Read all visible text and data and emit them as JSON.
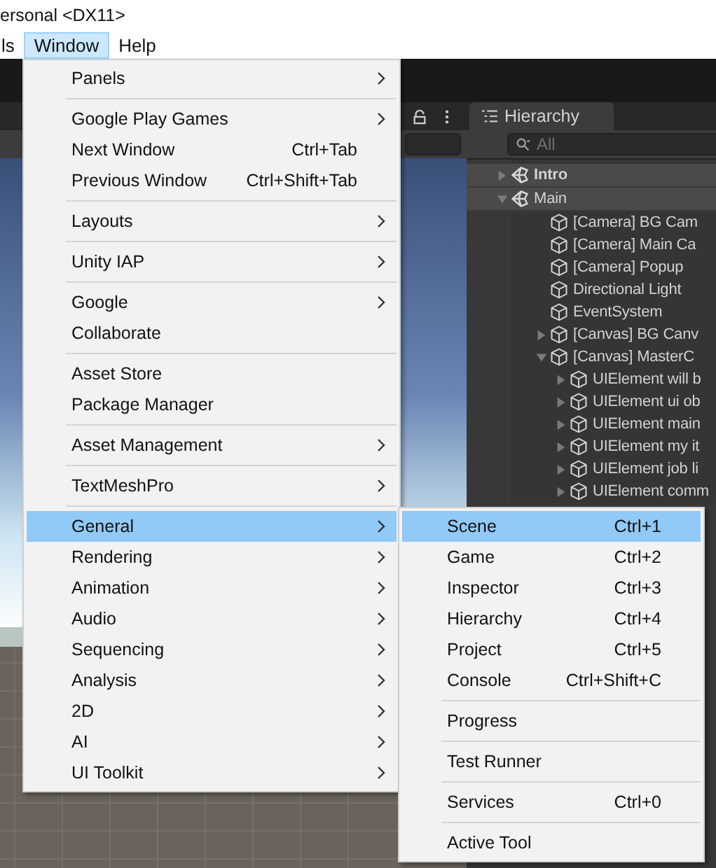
{
  "title_bar": {
    "title": "ersonal <DX11>"
  },
  "menu_bar": [
    {
      "label": "ls",
      "selected": false
    },
    {
      "label": "Window",
      "selected": true
    },
    {
      "label": "Help",
      "selected": false
    }
  ],
  "hierarchy": {
    "tab": "Hierarchy",
    "search": {
      "placeholder": "All"
    },
    "items": [
      {
        "label": "Intro",
        "kind": "scene",
        "active": true,
        "expanded": false
      },
      {
        "label": "Main",
        "kind": "scene",
        "active": false,
        "expanded": true,
        "children": [
          {
            "label": "[Camera] BG Cam",
            "kind": "object"
          },
          {
            "label": "[Camera] Main Ca",
            "kind": "object"
          },
          {
            "label": "[Camera] Popup",
            "kind": "object"
          },
          {
            "label": "Directional Light",
            "kind": "object"
          },
          {
            "label": "EventSystem",
            "kind": "object"
          },
          {
            "label": "[Canvas] BG Canv",
            "kind": "object",
            "expanded": false
          },
          {
            "label": "[Canvas] MasterC",
            "kind": "object",
            "expanded": true,
            "children": [
              {
                "label": "UIElement will b",
                "kind": "object",
                "expanded": false
              },
              {
                "label": "UIElement ui ob",
                "kind": "object",
                "expanded": false
              },
              {
                "label": "UIElement main",
                "kind": "object",
                "expanded": false
              },
              {
                "label": "UIElement my it",
                "kind": "object",
                "expanded": false
              },
              {
                "label": "UIElement job li",
                "kind": "object",
                "expanded": false
              },
              {
                "label": "UIElement comm",
                "kind": "object",
                "expanded": false
              }
            ]
          }
        ]
      }
    ]
  },
  "window_menu": {
    "groups": [
      [
        {
          "label": "Panels",
          "submenu": true,
          "selected": false
        }
      ],
      [
        {
          "label": "Google Play Games",
          "submenu": true,
          "selected": false
        },
        {
          "label": "Next Window",
          "shortcut": "Ctrl+Tab",
          "submenu": false,
          "selected": false
        },
        {
          "label": "Previous Window",
          "shortcut": "Ctrl+Shift+Tab",
          "submenu": false,
          "selected": false
        }
      ],
      [
        {
          "label": "Layouts",
          "submenu": true,
          "selected": false
        }
      ],
      [
        {
          "label": "Unity IAP",
          "submenu": true,
          "selected": false
        }
      ],
      [
        {
          "label": "Google",
          "submenu": true,
          "selected": false
        },
        {
          "label": "Collaborate",
          "submenu": false,
          "selected": false
        }
      ],
      [
        {
          "label": "Asset Store",
          "submenu": false,
          "selected": false
        },
        {
          "label": "Package Manager",
          "submenu": false,
          "selected": false
        }
      ],
      [
        {
          "label": "Asset Management",
          "submenu": true,
          "selected": false
        }
      ],
      [
        {
          "label": "TextMeshPro",
          "submenu": true,
          "selected": false
        }
      ],
      [
        {
          "label": "General",
          "submenu": true,
          "selected": true
        },
        {
          "label": "Rendering",
          "submenu": true,
          "selected": false
        },
        {
          "label": "Animation",
          "submenu": true,
          "selected": false
        },
        {
          "label": "Audio",
          "submenu": true,
          "selected": false
        },
        {
          "label": "Sequencing",
          "submenu": true,
          "selected": false
        },
        {
          "label": "Analysis",
          "submenu": true,
          "selected": false
        },
        {
          "label": "2D",
          "submenu": true,
          "selected": false
        },
        {
          "label": "AI",
          "submenu": true,
          "selected": false
        },
        {
          "label": "UI Toolkit",
          "submenu": true,
          "selected": false
        }
      ]
    ]
  },
  "general_submenu": {
    "groups": [
      [
        {
          "label": "Scene",
          "shortcut": "Ctrl+1",
          "submenu": false,
          "selected": true
        },
        {
          "label": "Game",
          "shortcut": "Ctrl+2",
          "submenu": false,
          "selected": false
        },
        {
          "label": "Inspector",
          "shortcut": "Ctrl+3",
          "submenu": false,
          "selected": false
        },
        {
          "label": "Hierarchy",
          "shortcut": "Ctrl+4",
          "submenu": false,
          "selected": false
        },
        {
          "label": "Project",
          "shortcut": "Ctrl+5",
          "submenu": false,
          "selected": false
        },
        {
          "label": "Console",
          "shortcut": "Ctrl+Shift+C",
          "submenu": false,
          "selected": false
        }
      ],
      [
        {
          "label": "Progress",
          "submenu": false,
          "selected": false
        }
      ],
      [
        {
          "label": "Test Runner",
          "submenu": false,
          "selected": false
        }
      ],
      [
        {
          "label": "Services",
          "shortcut": "Ctrl+0",
          "submenu": false,
          "selected": false
        }
      ],
      [
        {
          "label": "Active Tool",
          "submenu": false,
          "selected": false
        }
      ]
    ]
  }
}
